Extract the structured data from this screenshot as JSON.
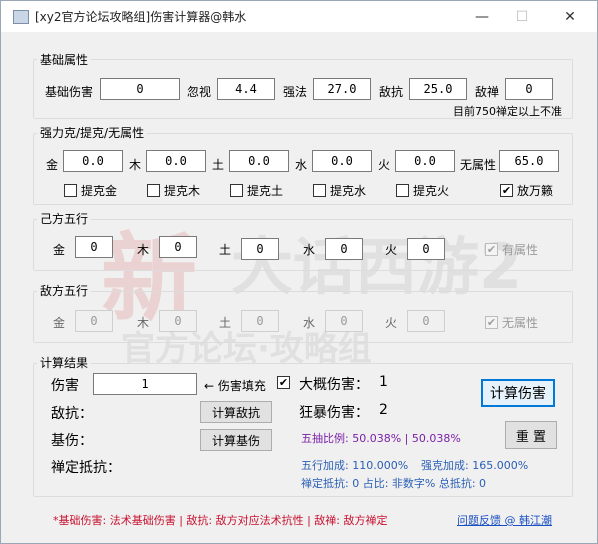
{
  "window": {
    "title": "[xy2官方论坛攻略组]伤害计算器@韩水",
    "minimize": "—",
    "maximize": "☐",
    "close": "✕"
  },
  "basic": {
    "title": "基础属性",
    "fields": [
      {
        "label": "基础伤害",
        "value": "0"
      },
      {
        "label": "忽视",
        "value": "4.4"
      },
      {
        "label": "强法",
        "value": "27.0"
      },
      {
        "label": "敌抗",
        "value": "25.0"
      },
      {
        "label": "敌禅",
        "value": "0"
      }
    ],
    "note": "目前750禅定以上不准"
  },
  "restraint": {
    "title": "强力克/提克/无属性",
    "fields": [
      {
        "label": "金",
        "value": "0.0"
      },
      {
        "label": "木",
        "value": "0.0"
      },
      {
        "label": "土",
        "value": "0.0"
      },
      {
        "label": "水",
        "value": "0.0"
      },
      {
        "label": "火",
        "value": "0.0"
      },
      {
        "label": "无属性",
        "value": "65.0"
      }
    ],
    "checks": [
      {
        "label": "提克金",
        "checked": false
      },
      {
        "label": "提克木",
        "checked": false
      },
      {
        "label": "提克土",
        "checked": false
      },
      {
        "label": "提克水",
        "checked": false
      },
      {
        "label": "提克火",
        "checked": false
      },
      {
        "label": "放万籁",
        "checked": true
      }
    ]
  },
  "own": {
    "title": "己方五行",
    "fields": [
      {
        "label": "金",
        "value": "0"
      },
      {
        "label": "木",
        "value": "0"
      },
      {
        "label": "土",
        "value": "0"
      },
      {
        "label": "水",
        "value": "0"
      },
      {
        "label": "火",
        "value": "0"
      }
    ],
    "check": {
      "label": "有属性",
      "checked": true
    }
  },
  "enemy": {
    "title": "敌方五行",
    "fields": [
      {
        "label": "金",
        "value": "0"
      },
      {
        "label": "木",
        "value": "0"
      },
      {
        "label": "土",
        "value": "0"
      },
      {
        "label": "水",
        "value": "0"
      },
      {
        "label": "火",
        "value": "0"
      }
    ],
    "check": {
      "label": "无属性",
      "checked": true
    }
  },
  "result": {
    "title": "计算结果",
    "damage_label": "伤害",
    "damage_value": "1",
    "fill_hint": "← 伤害填充",
    "approx_label": "大概伤害：",
    "approx_value": "1",
    "crit_label": "狂暴伤害：",
    "crit_value": "2",
    "resist_label": "敌抗：",
    "base_label": "基伤：",
    "zen_label": "禅定抵抗：",
    "calc_resist_btn": "计算敌抗",
    "calc_base_btn": "计算基伤",
    "calc_damage_btn": "计算伤害",
    "reset_btn": "重 置",
    "five_ratio": "五抽比例: 50.038% | 50.038%",
    "element_bonus": "五行加成: 110.000%",
    "restrain_bonus": "强克加成: 165.000%",
    "zen_stats": "禅定抵抗: 0  占比: 非数字%  总抵抗: 0"
  },
  "footer": {
    "note": "*基础伤害: 法术基础伤害 | 敌抗: 敌方对应法术抗性 | 敌禅: 敌方禅定",
    "link": "问题反馈 @ 韩江潮"
  },
  "colors": {
    "accent": "#0078d7",
    "footer_note": "#c8102e",
    "link": "#1a4fc2",
    "stats_blue": "#2a5fb5",
    "ratio_purple": "#7a1fa8"
  }
}
